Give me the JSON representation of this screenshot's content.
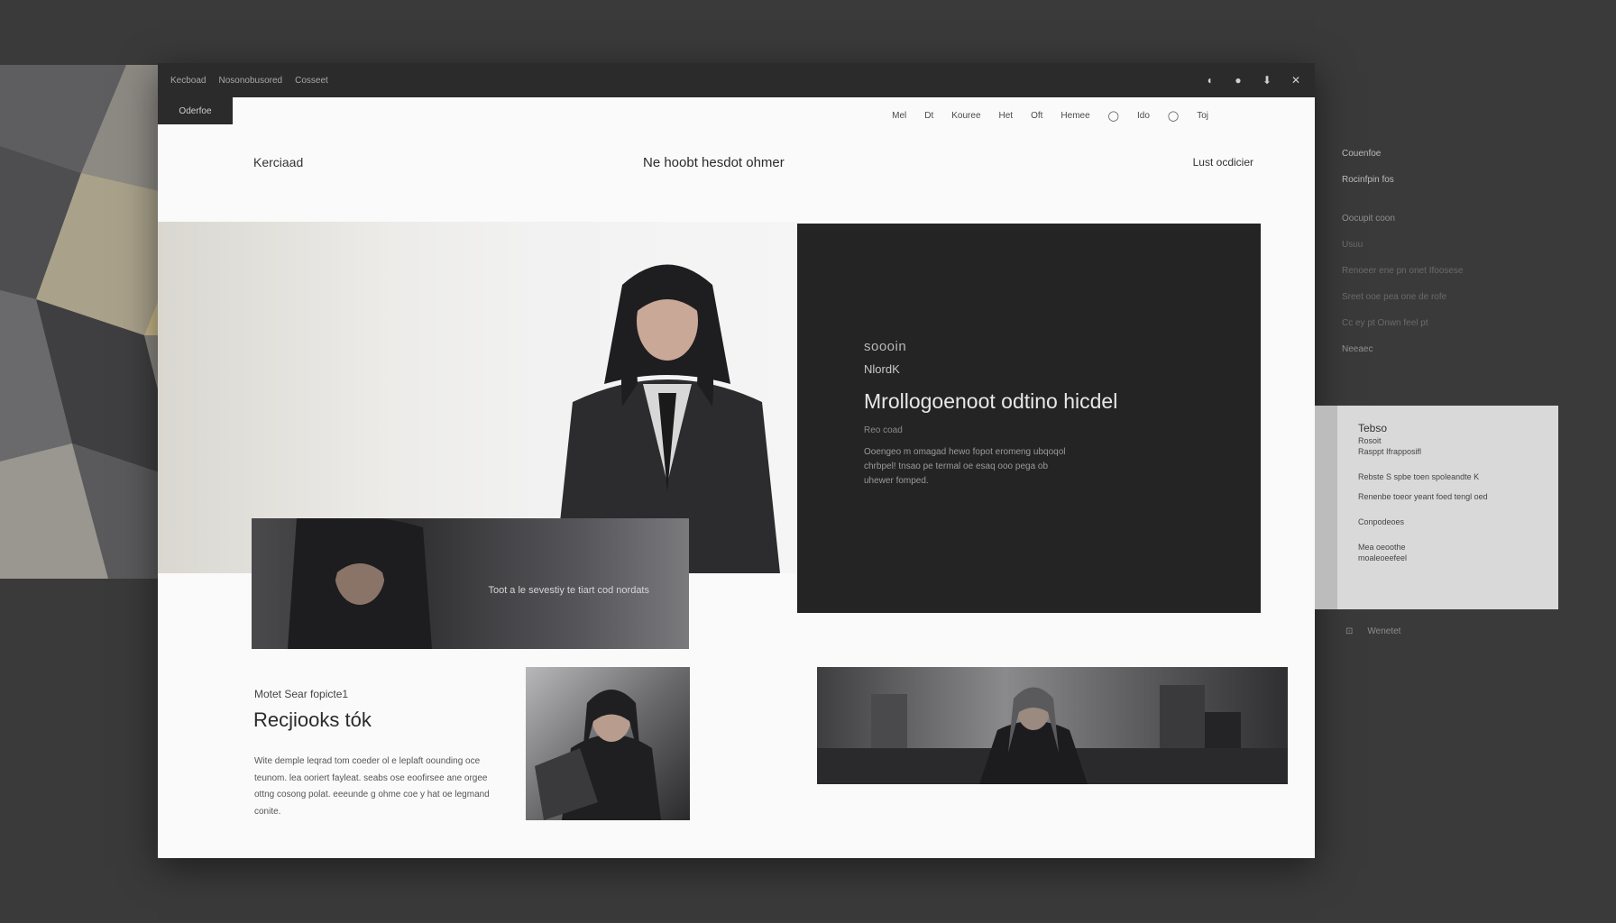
{
  "titlebar": {
    "items": [
      "Kecboad",
      "Nosonobusored",
      "Cosseet"
    ],
    "active_tab": "Oderfoe",
    "controls": [
      "pin-icon",
      "circle-icon",
      "download-icon",
      "expand-icon"
    ]
  },
  "nav": {
    "items": [
      "Mel",
      "Dt",
      "Kouree",
      "Het",
      "Oft",
      "Hemee",
      "search-icon",
      "Ido",
      "search-icon",
      "Toj"
    ],
    "labels": [
      "Mel",
      "Dt",
      "Kouree",
      "Het",
      "Oft",
      "Hemee",
      "Ido",
      "Toj"
    ]
  },
  "header": {
    "left": "Kerciaad",
    "center": "Ne hoobt hesdot ohmer",
    "right": "Lust ocdicier"
  },
  "feature": {
    "eyebrow": "soooin",
    "sub": "NlordK",
    "title": "Mrollogoenoot odtino hicdel",
    "small": "Reo coad",
    "body": "Ooengeo m omagad hewo fopot eromeng ubqoqol chrbpel! tnsao pe termal oe esaq ooo pega ob uhewer fomped."
  },
  "banner": {
    "caption": "Toot a le sevestiy te tiart cod nordats"
  },
  "bottom_left": {
    "eyebrow": "Motet Sear fopicte1",
    "title": "Recjiooks tók",
    "body": "Wite demple leqrad tom coeder ol e leplaft oounding oce teunom. lea ooriert fayleat. seabs ose eoofirsee ane orgee ottng cosong polat. eeeunde g ohme coe y hat oe legmand conite."
  },
  "side_list": {
    "items": [
      "Couenfoe",
      "Rocinfpin fos",
      "Oocupit coon",
      "Usuu",
      "Renoeer ene pn onet Ifoosese",
      "Sreet ooe pea one de rofe",
      "Cc ey pt Onwn feel pt",
      "Neeaec"
    ]
  },
  "side_card": {
    "title": "Tebso",
    "line1": "Rosoit",
    "line2": "Rasppt Ifrapposifl",
    "line3": "Rebste S spbe toen spoleandte K",
    "line4": "Renenbe toeor yeant foed tengl oed",
    "line5": "Conpodeoes",
    "line6": "Mea oeoothe",
    "line7": "moaleoeefeel"
  },
  "side_footer": {
    "icon": "camera-icon",
    "label": "Wenetet"
  },
  "colors": {
    "bg": "#3a3a3b",
    "titlebar": "#2b2b2c",
    "feature_panel": "#242424",
    "window": "#fafafa",
    "accent_gold": "#b8a77a"
  }
}
